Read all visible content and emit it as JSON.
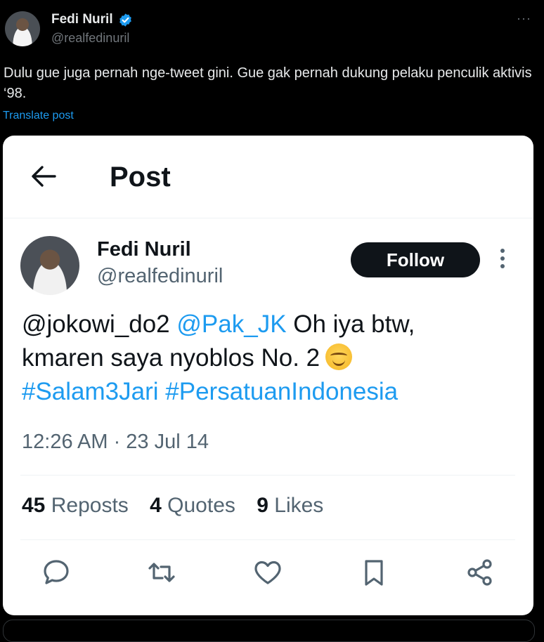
{
  "outer_post": {
    "author_name": "Fedi Nuril",
    "author_handle": "@realfedinuril",
    "more_label": "···",
    "text": "Dulu gue juga pernah nge-tweet gini. Gue gak pernah dukung pelaku penculik aktivis ‘98.",
    "translate_label": "Translate post",
    "icons": [
      "verified-badge-icon",
      "more-icon"
    ]
  },
  "embedded_screenshot": {
    "header_title": "Post",
    "author_name": "Fedi Nuril",
    "author_handle": "@realfedinuril",
    "follow_label": "Follow",
    "body": {
      "mention1": "@jokowi_do2",
      "mention2": "@Pak_JK",
      "text1": " Oh iya btw,",
      "text2": "kmaren saya nyoblos No. 2",
      "hashtag1": "#Salam3Jari",
      "hashtag2": "#PersatuanIndonesia"
    },
    "timestamp": "12:26 AM · 23 Jul 14",
    "stats": {
      "reposts_count": "45",
      "reposts_label": "Reposts",
      "quotes_count": "4",
      "quotes_label": "Quotes",
      "likes_count": "9",
      "likes_label": "Likes"
    },
    "action_icons": [
      "reply-icon",
      "repost-icon",
      "like-icon",
      "bookmark-icon",
      "share-icon"
    ]
  },
  "colors": {
    "background": "#000000",
    "card": "#ffffff",
    "link": "#1d9bf0",
    "muted": "#536471",
    "follow_button": "#0f1419"
  }
}
